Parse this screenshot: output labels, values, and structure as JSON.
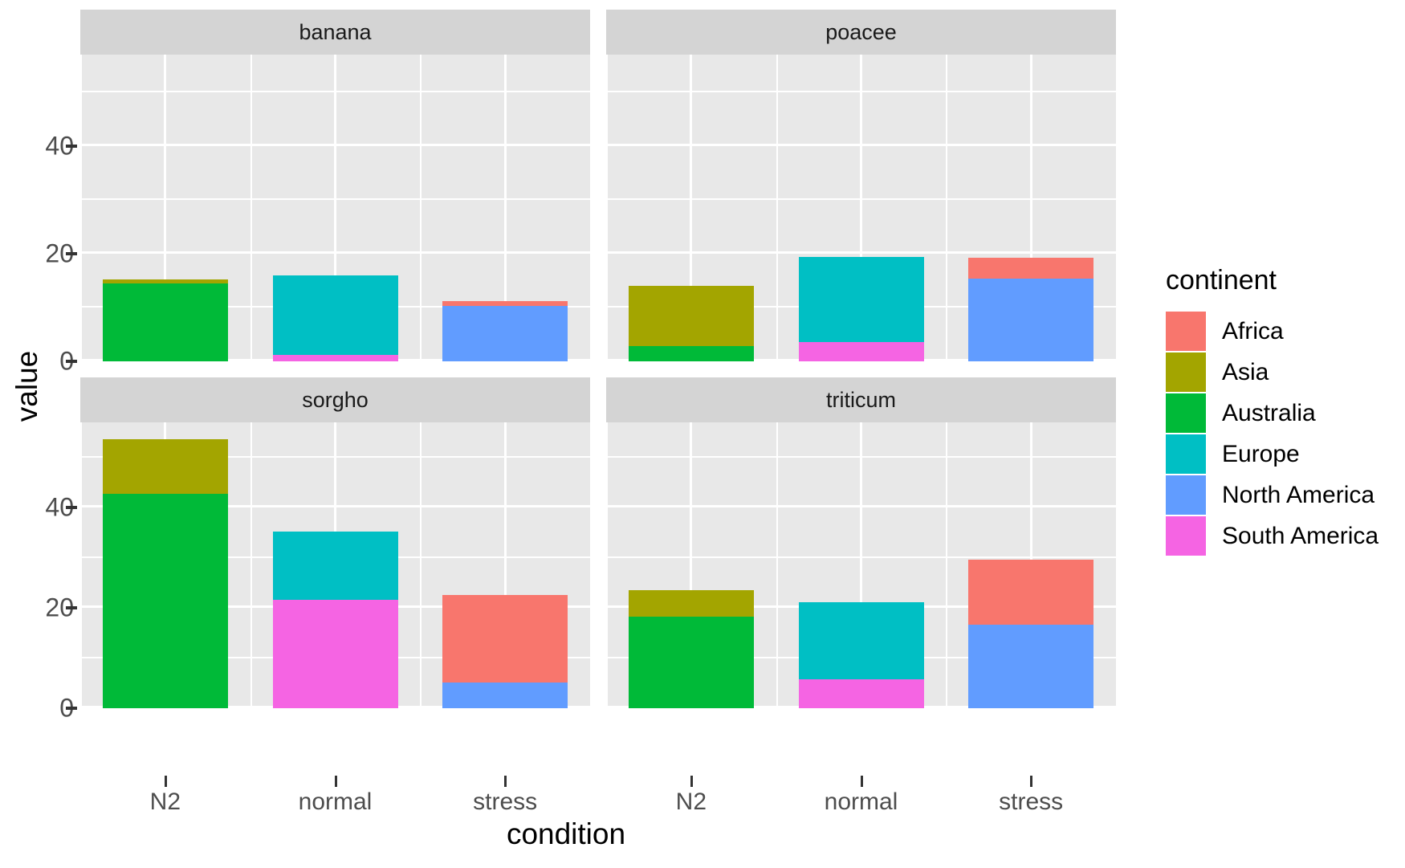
{
  "chart_data": {
    "type": "bar",
    "subtype": "stacked-bar-faceted",
    "title": "",
    "xlabel": "condition",
    "ylabel": "value",
    "categories": [
      "N2",
      "normal",
      "stress"
    ],
    "facets": [
      "banana",
      "poacee",
      "sorgho",
      "triticum"
    ],
    "facet_layout": "2x2",
    "legend_title": "continent",
    "legend_position": "right",
    "grid": true,
    "yticks_top": [
      "0",
      "20",
      "40"
    ],
    "yticks_bottom": [
      "0",
      "20",
      "40"
    ],
    "ytick_values_top": [
      0,
      20,
      40
    ],
    "ytick_values_bottom": [
      0,
      20,
      40
    ],
    "ylim_top": [
      0,
      57
    ],
    "ylim_bottom": [
      0,
      57
    ],
    "series": [
      {
        "name": "Africa",
        "color": "#F8766D"
      },
      {
        "name": "Asia",
        "color": "#A3A500"
      },
      {
        "name": "Australia",
        "color": "#00BA38"
      },
      {
        "name": "Europe",
        "color": "#00BFC4"
      },
      {
        "name": "North America",
        "color": "#619CFF"
      },
      {
        "name": "South America",
        "color": "#F564E3"
      }
    ],
    "panels": [
      {
        "facet": "banana",
        "bars": [
          {
            "condition": "N2",
            "total": 15.2,
            "segments": [
              {
                "continent": "Australia",
                "value": 14.5
              },
              {
                "continent": "Asia",
                "value": 0.7
              }
            ]
          },
          {
            "condition": "normal",
            "total": 16.0,
            "segments": [
              {
                "continent": "South America",
                "value": 1.2
              },
              {
                "continent": "Europe",
                "value": 14.8
              }
            ]
          },
          {
            "condition": "stress",
            "total": 11.2,
            "segments": [
              {
                "continent": "North America",
                "value": 10.3
              },
              {
                "continent": "Africa",
                "value": 0.9
              }
            ]
          }
        ]
      },
      {
        "facet": "poacee",
        "bars": [
          {
            "condition": "N2",
            "total": 14.0,
            "segments": [
              {
                "continent": "Australia",
                "value": 2.8
              },
              {
                "continent": "Asia",
                "value": 11.2
              }
            ]
          },
          {
            "condition": "normal",
            "total": 19.4,
            "segments": [
              {
                "continent": "South America",
                "value": 3.6
              },
              {
                "continent": "Europe",
                "value": 15.8
              }
            ]
          },
          {
            "condition": "stress",
            "total": 19.3,
            "segments": [
              {
                "continent": "North America",
                "value": 15.3
              },
              {
                "continent": "Africa",
                "value": 4.0
              }
            ]
          }
        ]
      },
      {
        "facet": "sorgho",
        "bars": [
          {
            "condition": "N2",
            "total": 53.6,
            "segments": [
              {
                "continent": "Australia",
                "value": 42.8
              },
              {
                "continent": "Asia",
                "value": 10.8
              }
            ]
          },
          {
            "condition": "normal",
            "total": 35.3,
            "segments": [
              {
                "continent": "South America",
                "value": 21.6
              },
              {
                "continent": "Europe",
                "value": 13.7
              }
            ]
          },
          {
            "condition": "stress",
            "total": 22.5,
            "segments": [
              {
                "continent": "North America",
                "value": 5.2
              },
              {
                "continent": "Africa",
                "value": 17.3
              }
            ]
          }
        ]
      },
      {
        "facet": "triticum",
        "bars": [
          {
            "condition": "N2",
            "total": 23.5,
            "segments": [
              {
                "continent": "Australia",
                "value": 18.3
              },
              {
                "continent": "Asia",
                "value": 5.2
              }
            ]
          },
          {
            "condition": "normal",
            "total": 21.1,
            "segments": [
              {
                "continent": "South America",
                "value": 5.8
              },
              {
                "continent": "Europe",
                "value": 15.3
              }
            ]
          },
          {
            "condition": "stress",
            "total": 29.7,
            "segments": [
              {
                "continent": "North America",
                "value": 16.7
              },
              {
                "continent": "Africa",
                "value": 13.0
              }
            ]
          }
        ]
      }
    ]
  },
  "axes": {
    "y_title": "value",
    "x_title": "condition"
  },
  "legend": {
    "title": "continent",
    "items": [
      {
        "label": "Africa",
        "color": "#F8766D"
      },
      {
        "label": "Asia",
        "color": "#A3A500"
      },
      {
        "label": "Australia",
        "color": "#00BA38"
      },
      {
        "label": "Europe",
        "color": "#00BFC4"
      },
      {
        "label": "North America",
        "color": "#619CFF"
      },
      {
        "label": "South America",
        "color": "#F564E3"
      }
    ]
  },
  "theme": {
    "panel_background": "#E8E8E8",
    "strip_background": "#D4D4D4",
    "gridline_color": "#FFFFFF",
    "text_color": "#1A1A1A",
    "tick_label_color": "#4D4D4D",
    "plot_background": "#FFFFFF"
  }
}
